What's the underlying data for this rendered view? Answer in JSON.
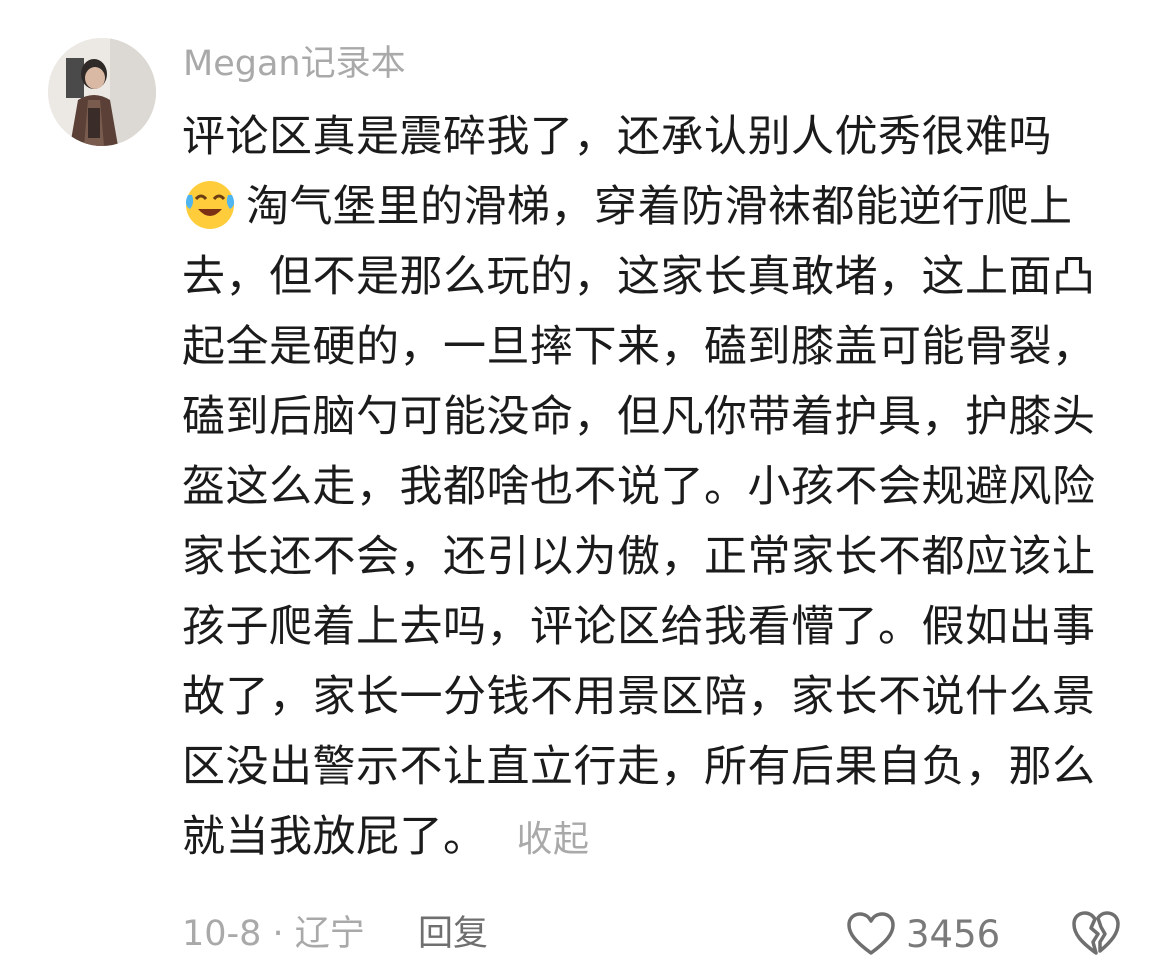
{
  "comment": {
    "username": "Megan记录本",
    "lines": [
      "评论区真是震碎我了，还承认别人优秀很难吗",
      "淘气堡里的滑梯，穿着防滑袜都能逆行爬上",
      "去，但不是那么玩的，这家长真敢堵，这上面凸",
      "起全是硬的，一旦摔下来，磕到膝盖可能骨裂，",
      "磕到后脑勺可能没命，但凡你带着护具，护膝头",
      "盔这么走，我都啥也不说了。小孩不会规避风险",
      "家长还不会，还引以为傲，正常家长不都应该让",
      "孩子爬着上去吗，评论区给我看懵了。假如出事",
      "故了，家长一分钱不用景区陪，家长不说什么景",
      "区没出警示不让直立行走，所有后果自负，那么",
      "就当我放屁了。"
    ],
    "collapse_label": "收起",
    "date_location": "10-8 · 辽宁",
    "reply_label": "回复",
    "like_count": "3456",
    "emoji_icon": "crying-laughing-emoji-icon"
  }
}
